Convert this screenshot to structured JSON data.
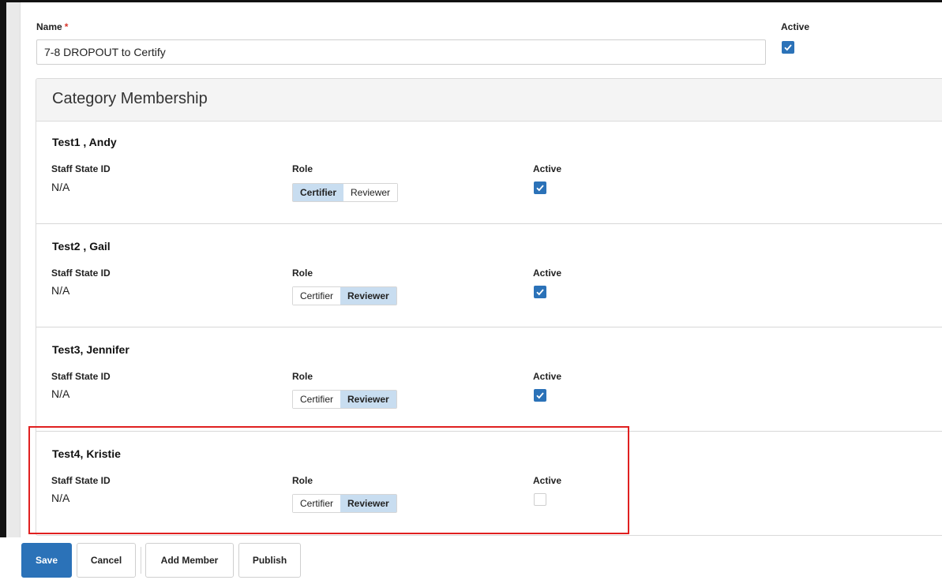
{
  "form": {
    "name_label": "Name",
    "required_marker": "*",
    "name_value": "7-8 DROPOUT to Certify",
    "active_label": "Active",
    "active_checked": true
  },
  "panel": {
    "title": "Category Membership"
  },
  "columns": {
    "staff_state_id": "Staff State ID",
    "role": "Role",
    "active": "Active"
  },
  "members": [
    {
      "name": "Test1 , Andy",
      "staff_state_id": "N/A",
      "role_options": [
        "Certifier",
        "Reviewer"
      ],
      "selected_role": "Certifier",
      "active": true
    },
    {
      "name": "Test2 , Gail",
      "staff_state_id": "N/A",
      "role_options": [
        "Certifier",
        "Reviewer"
      ],
      "selected_role": "Reviewer",
      "active": true
    },
    {
      "name": "Test3, Jennifer",
      "staff_state_id": "N/A",
      "role_options": [
        "Certifier",
        "Reviewer"
      ],
      "selected_role": "Reviewer",
      "active": true
    },
    {
      "name": "Test4, Kristie",
      "staff_state_id": "N/A",
      "role_options": [
        "Certifier",
        "Reviewer"
      ],
      "selected_role": "Reviewer",
      "active": false
    }
  ],
  "footer": {
    "save": "Save",
    "cancel": "Cancel",
    "add_member": "Add Member",
    "publish": "Publish"
  },
  "colors": {
    "primary": "#2b72b8",
    "selected_role": "#c8ddf0",
    "highlight": "#e02020",
    "required": "#d9342b"
  }
}
